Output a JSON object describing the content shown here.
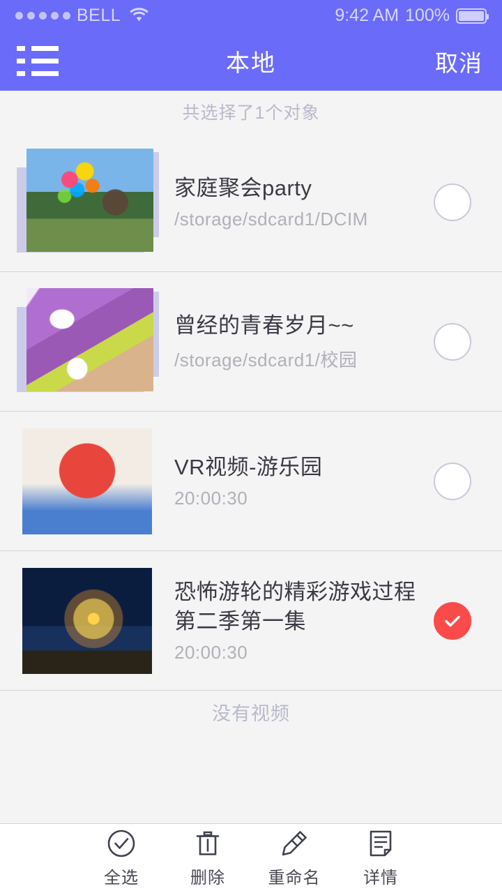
{
  "status_bar": {
    "carrier": "BELL",
    "signal_dots": 5,
    "wifi_icon": "wifi-icon",
    "time": "9:42 AM",
    "battery_percent": "100%",
    "battery_icon": "battery-full-icon"
  },
  "nav": {
    "menu_icon": "list-menu-icon",
    "title": "本地",
    "cancel_label": "取消"
  },
  "selection": {
    "summary": "共选择了1个对象"
  },
  "list": {
    "items": [
      {
        "title": "家庭聚会party",
        "subtitle": "/storage/sdcard1/DCIM",
        "checked": false,
        "stacked": true,
        "thumb_class": "art-party",
        "thumb_name": "thumbnail-family-party"
      },
      {
        "title": "曾经的青春岁月~~",
        "subtitle": "/storage/sdcard1/校园",
        "checked": false,
        "stacked": true,
        "thumb_class": "art-board",
        "thumb_name": "thumbnail-skateboard"
      },
      {
        "title": "VR视频-游乐园",
        "subtitle": "20:00:30",
        "checked": false,
        "stacked": false,
        "thumb_class": "art-vr",
        "thumb_name": "thumbnail-vr-video"
      },
      {
        "title": "恐怖游轮的精彩游戏过程\n第二季第一集",
        "subtitle": "20:00:30",
        "checked": true,
        "stacked": false,
        "thumb_class": "art-ferris",
        "thumb_name": "thumbnail-ferris-wheel"
      }
    ]
  },
  "empty_note": "没有视频",
  "toolbar": {
    "items": [
      {
        "label": "全选",
        "icon": "check-circle-icon"
      },
      {
        "label": "删除",
        "icon": "trash-icon"
      },
      {
        "label": "重命名",
        "icon": "pencil-icon"
      },
      {
        "label": "详情",
        "icon": "document-icon"
      }
    ]
  },
  "colors": {
    "accent_purple": "#6b6bfa",
    "selected_red": "#fa4b4b",
    "page_background": "#f4f4f5",
    "divider": "#d3d3dd",
    "title_text": "#3a3a44",
    "subtitle_text": "#b0b0b8",
    "muted_text": "#b9b9cc",
    "stack_plate": "#ccccea"
  }
}
